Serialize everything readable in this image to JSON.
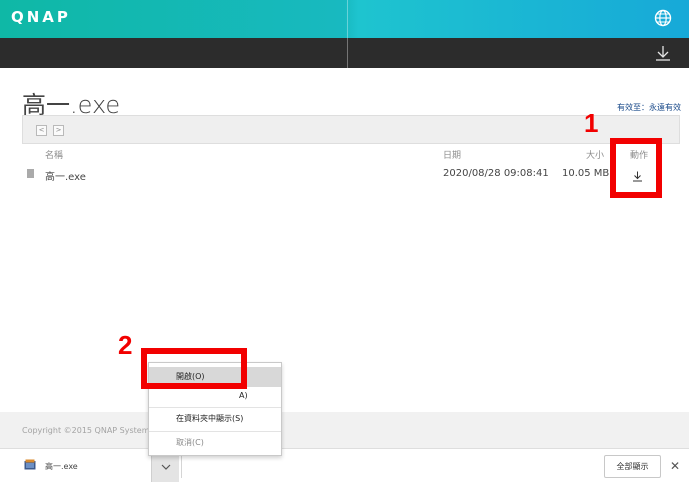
{
  "header": {
    "logo": "QNAP",
    "globe_icon": "globe-icon",
    "download_icon": "download-icon"
  },
  "page": {
    "title": "高一.exe",
    "expiry": "有效至：永遠有效"
  },
  "nav": {
    "back": "<",
    "forward": ">"
  },
  "table": {
    "columns": {
      "name": "名稱",
      "date": "日期",
      "size": "大小",
      "action": "動作"
    },
    "rows": [
      {
        "name": "高一.exe",
        "date": "2020/08/28 09:08:41",
        "size": "10.05 MB",
        "action_icon": "download-icon"
      }
    ]
  },
  "annotations": {
    "box1": "1",
    "box2": "2",
    "color": "#f20000"
  },
  "footer": {
    "copyright": "Copyright ©2015 QNAP Systems"
  },
  "download_bar": {
    "filename": "高一.exe",
    "show_all": "全部顯示",
    "close": "✕"
  },
  "context_menu": {
    "items": [
      {
        "label": "開啟(O)"
      },
      {
        "label": "A)"
      },
      {
        "label": "在資料夾中顯示(S)"
      },
      {
        "label": "取消(C)"
      }
    ]
  }
}
